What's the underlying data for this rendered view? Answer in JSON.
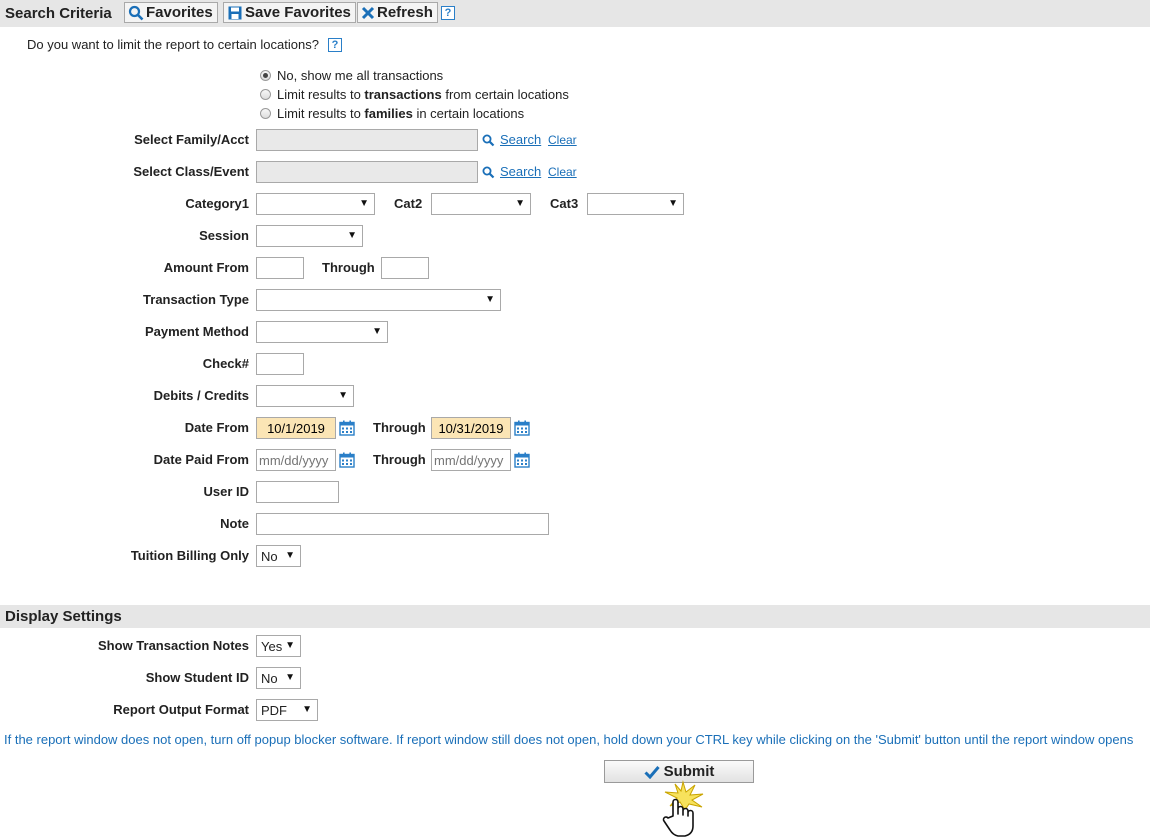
{
  "toolbar": {
    "title": "Search Criteria",
    "favorites_label": "Favorites",
    "save_favorites_label": "Save Favorites",
    "refresh_label": "Refresh",
    "help_label": "?"
  },
  "location": {
    "question": "Do you want to limit the report to certain locations?",
    "options": {
      "opt1": "No, show me all transactions",
      "opt2_pre": "Limit results to ",
      "opt2_bold": "transactions",
      "opt2_post": " from certain locations",
      "opt3_pre": "Limit results to ",
      "opt3_bold": "families",
      "opt3_post": " in certain locations"
    }
  },
  "form": {
    "family_label": "Select Family/Acct",
    "class_label": "Select Class/Event",
    "search_label": "Search",
    "clear_label": "Clear",
    "category1_label": "Category1",
    "cat2_label": "Cat2",
    "cat3_label": "Cat3",
    "session_label": "Session",
    "amount_from_label": "Amount From",
    "through_label": "Through",
    "transaction_type_label": "Transaction Type",
    "payment_method_label": "Payment Method",
    "check_label": "Check#",
    "debits_credits_label": "Debits / Credits",
    "date_from_label": "Date From",
    "date_from_value": "10/1/2019",
    "date_through_value": "10/31/2019",
    "date_paid_from_label": "Date Paid From",
    "date_placeholder": "mm/dd/yyyy",
    "user_id_label": "User ID",
    "note_label": "Note",
    "tuition_billing_label": "Tuition Billing Only",
    "tuition_billing_value": "No"
  },
  "display": {
    "title": "Display Settings",
    "show_notes_label": "Show Transaction Notes",
    "show_notes_value": "Yes",
    "show_student_id_label": "Show Student ID",
    "show_student_id_value": "No",
    "output_format_label": "Report Output Format",
    "output_format_value": "PDF"
  },
  "notice": "If the report window does not open, turn off popup blocker software. If report window still does not open, hold down your CTRL key while clicking on the 'Submit' button until the report window opens",
  "submit_label": "Submit",
  "colors": {
    "accent": "#1a6fb8",
    "date_fill": "#fbe5b5",
    "header_bg": "#e6e6e6"
  }
}
